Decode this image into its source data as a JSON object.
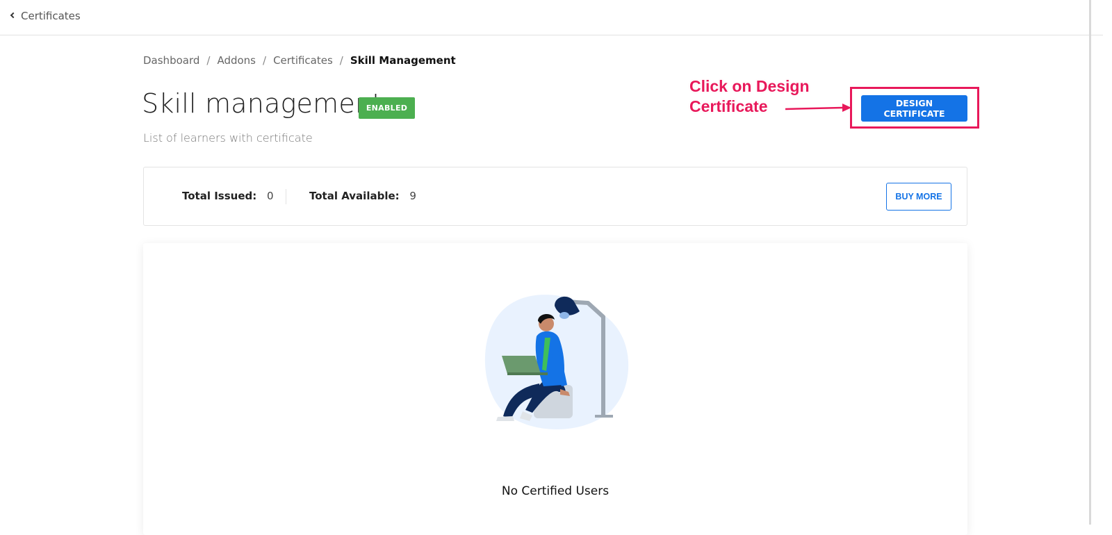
{
  "topbar": {
    "back_label": "Certificates"
  },
  "breadcrumb": {
    "items": [
      "Dashboard",
      "Addons",
      "Certificates",
      "Skill Management"
    ],
    "separator": "/"
  },
  "header": {
    "title": "Skill management",
    "status_badge": "ENABLED",
    "subtitle": "List of learners with certificate",
    "design_button_label": "DESIGN CERTIFICATE"
  },
  "annotation": {
    "line1": "Click on Design",
    "line2": "Certificate",
    "color": "#e8185a"
  },
  "stats": {
    "issued_label": "Total Issued:",
    "issued_value": "0",
    "available_label": "Total Available:",
    "available_value": "9",
    "buy_more_label": "BUY MORE"
  },
  "empty_state": {
    "message": "No Certified Users",
    "illustration": "person-with-laptop-under-lamp"
  },
  "colors": {
    "primary": "#1473e6",
    "success": "#4caf50",
    "annotation": "#e8185a"
  }
}
